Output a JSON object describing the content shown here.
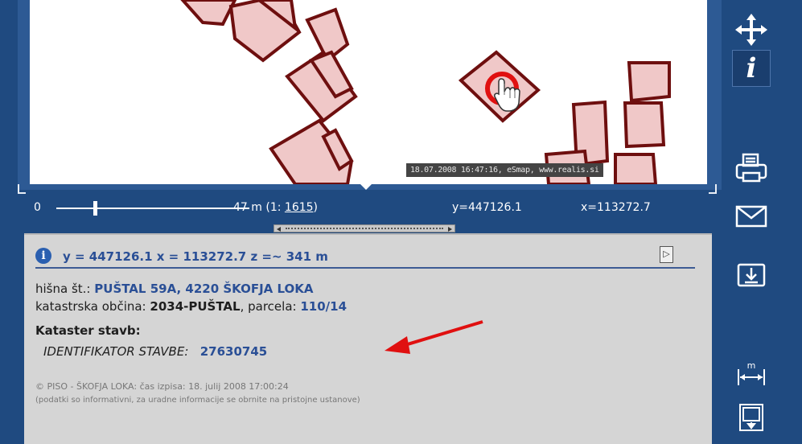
{
  "map": {
    "timestamp_text": "18.07.2008 16:47:16, eSmap, www.realis.si"
  },
  "scale_bar": {
    "zero_label": "0",
    "distance_label": "47 m (1:",
    "scale_value": "1615",
    "scale_close": ")",
    "coord_y": "y=447126.1",
    "coord_x": "x=113272.7"
  },
  "info": {
    "coord_line": "y = 447126.1  x = 113272.7  z =~ 341 m",
    "house_label": "hišna št.:",
    "house_value": "PUŠTAL 59A, 4220 ŠKOFJA LOKA",
    "cad_label": "katastrska občina:",
    "cad_value": "2034-PUŠTAL",
    "parcel_label": ", parcela:",
    "parcel_value": "110/14",
    "building_heading": "Kataster stavb:",
    "ident_label": "IDENTIFIKATOR STAVBE:",
    "ident_value": "27630745",
    "copyright": "© PISO - ŠKOFJA LOKA: čas izpisa: 18. julij 2008 17:00:24",
    "note": "(podatki so informativni, za uradne informacije se obrnite na pristojne ustanove)"
  },
  "colors": {
    "frame_blue": "#1f4a80",
    "parcel_fill": "#f0c8c8",
    "parcel_stroke": "#6e0f0f",
    "highlight_red": "#e01010",
    "value_blue": "#2a4f96"
  },
  "toolbar": {
    "icons": [
      "pan-icon",
      "info-icon",
      "print-icon",
      "mail-icon",
      "export-icon",
      "measure-icon",
      "zoom-extent-icon"
    ]
  }
}
